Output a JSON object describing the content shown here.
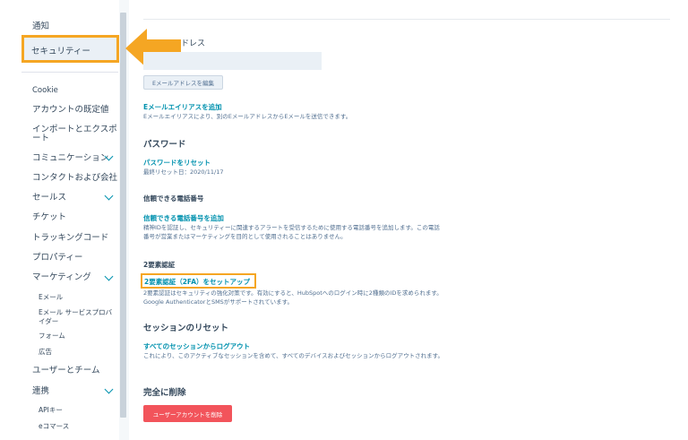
{
  "sidebar": {
    "items": [
      {
        "label": "通知"
      },
      {
        "label": "セキュリティー"
      },
      {
        "label": "Cookie"
      },
      {
        "label": "アカウントの既定値"
      },
      {
        "label": "インポートとエクスポート"
      },
      {
        "label": "コミュニケーション"
      },
      {
        "label": "コンタクトおよび会社"
      },
      {
        "label": "セールス"
      },
      {
        "label": "チケット"
      },
      {
        "label": "トラッキングコード"
      },
      {
        "label": "プロパティー"
      },
      {
        "label": "マーケティング"
      },
      {
        "label": "Eメール"
      },
      {
        "label": "Eメール サービスプロバイダー"
      },
      {
        "label": "フォーム"
      },
      {
        "label": "広告"
      },
      {
        "label": "ユーザーとチーム"
      },
      {
        "label": "連携"
      },
      {
        "label": "APIキー"
      },
      {
        "label": "eコマース"
      }
    ]
  },
  "email": {
    "label_partial": "ドレス",
    "value": "",
    "edit_button": "Eメールアドレスを編集"
  },
  "alias": {
    "link": "Eメールエイリアスを追加",
    "desc": "Eメールエイリアスにより、別のEメールアドレスからEメールを送信できます。"
  },
  "password": {
    "heading": "パスワード",
    "link": "パスワードをリセット",
    "last_reset": "最終リセット日：2020/11/17"
  },
  "phone": {
    "heading": "信頼できる電話番号",
    "link": "信頼できる電話番号を追加",
    "desc": "精神IDを認証し、セキュリティーに関連するアラートを受信するために使用する電話番号を追加します。この電話番号が営業またはマーケティングを目的として使用されることはありません。"
  },
  "twofa": {
    "heading": "2要素認証",
    "link": "2要素認証（2FA）をセットアップ",
    "desc": "2要素認証はセキュリティの強化対策です。有効にすると、HubSpotへのログイン時に2種類のIDを求められます。Google AuthenticatorとSMSがサポートされています。"
  },
  "sessions": {
    "heading": "セッションのリセット",
    "link": "すべてのセッションからログアウト",
    "desc": "これにより、このアクティブなセッションを含めて、すべてのデバイスおよびセッションからログアウトされます。"
  },
  "delete": {
    "heading": "完全に削除",
    "button": "ユーザーアカウントを削除"
  },
  "colors": {
    "highlight": "#f5a623",
    "link": "#0091ae",
    "danger": "#f2545b"
  }
}
